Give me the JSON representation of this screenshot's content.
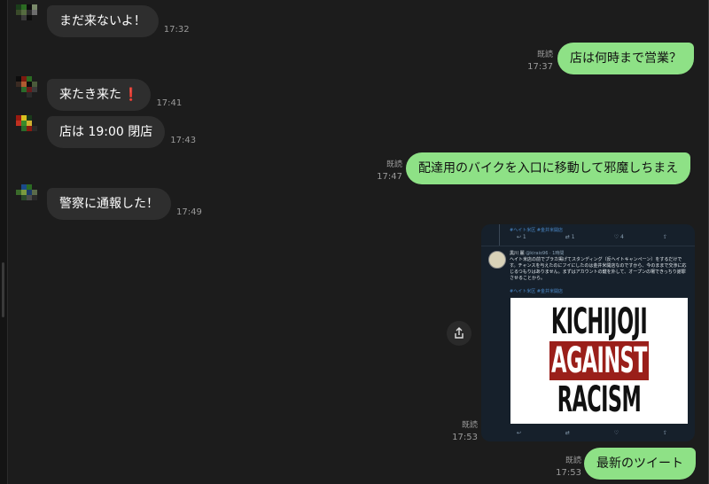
{
  "messages": [
    {
      "text": "まだ来ないよ！",
      "time": "17:32"
    },
    {
      "text": "店は何時まで営業？",
      "read": "既読",
      "time": "17:37"
    },
    {
      "text": "来たき来た",
      "emoji": "❗",
      "time": "17:41"
    },
    {
      "text": "店は 19:00 閉店",
      "time": "17:43"
    },
    {
      "text": "配達用のバイクを入口に移動して邪魔しちまえ",
      "read": "既読",
      "time": "17:47"
    },
    {
      "text": "警察に通報した！",
      "time": "17:49"
    },
    {
      "read": "既読",
      "time": "17:53"
    },
    {
      "text": "最新のツイート",
      "read": "既読",
      "time": "17:53"
    }
  ],
  "tweet": {
    "top_tags": "#ヘイト米区 #金井米開店",
    "actions_top": [
      "↩ 1",
      "⇄ 1",
      "♡ 4",
      "⇪"
    ],
    "author": "黒川 麗",
    "handle": "@kiraio96 · 1時間",
    "body": "ヘイト米店の前でプラカ掲げてスタンディング（反ヘイトキャンペーン）をするだけです。チャンスを与えたのにフイにしたのは金井米開店なのですから、今のままで交渉に応じるつもりはありません。まずはアカウントの鍵を外して、オープンの場できっちり謝罪させることから。",
    "tags": "#ヘイト米区 #金井米開店",
    "poster_lines": [
      "KICHIJOJI",
      "AGAINST",
      "RACISM"
    ],
    "actions_bottom": [
      "↩",
      "⇄",
      "♡",
      "⇪"
    ]
  },
  "icons": {
    "share": "share-icon"
  },
  "colors": {
    "outgoing_bubble": "#8ee186",
    "incoming_bubble": "#2e2e2e",
    "background": "#1c1c1c"
  }
}
